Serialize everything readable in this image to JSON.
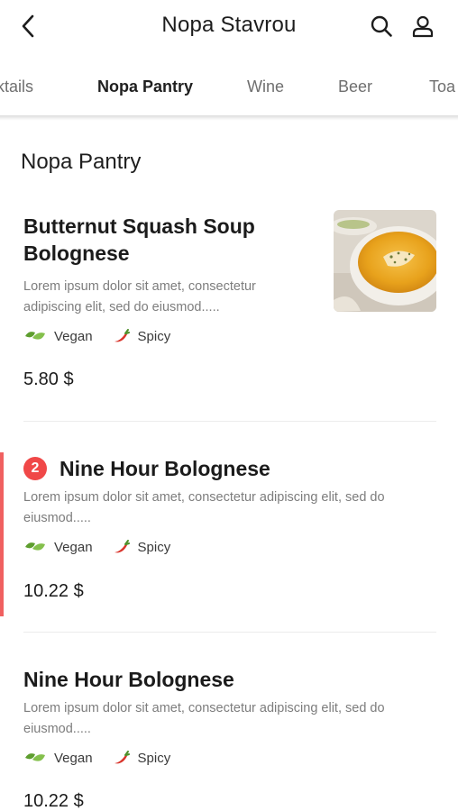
{
  "header": {
    "title": "Nopa Stavrou"
  },
  "tabs": [
    {
      "label": "ktails",
      "active": false
    },
    {
      "label": "Nopa Pantry",
      "active": true
    },
    {
      "label": "Wine",
      "active": false
    },
    {
      "label": "Beer",
      "active": false
    },
    {
      "label": "Toa",
      "active": false
    }
  ],
  "section": {
    "title": "Nopa Pantry"
  },
  "items": [
    {
      "name_line1": "Butternut Squash Soup",
      "name_line2": "Bolognese",
      "desc_line1": "Lorem ipsum dolor sit amet, consectetur",
      "desc_line2": "adipiscing elit, sed do eiusmod.....",
      "tag_vegan": "Vegan",
      "tag_spicy": "Spicy",
      "price": "5.80 $"
    },
    {
      "quantity": "2",
      "name": "Nine Hour Bolognese",
      "desc_line1": "Lorem ipsum dolor sit amet, consectetur adipiscing elit, sed do",
      "desc_line2": "eiusmod.....",
      "tag_vegan": "Vegan",
      "tag_spicy": "Spicy",
      "price": "10.22 $"
    },
    {
      "name": "Nine Hour Bolognese",
      "desc_line1": "Lorem ipsum dolor sit amet, consectetur adipiscing elit, sed do",
      "desc_line2": "eiusmod.....",
      "tag_vegan": "Vegan",
      "tag_spicy": "Spicy",
      "price": "10.22 $"
    }
  ],
  "colors": {
    "accent": "#f04848",
    "vegan_leaf": "#6cae3a",
    "spicy_pepper": "#d9342b"
  },
  "icons": [
    "chevron-left-icon",
    "search-icon",
    "user-icon",
    "leaf-icon",
    "chili-pepper-icon"
  ]
}
